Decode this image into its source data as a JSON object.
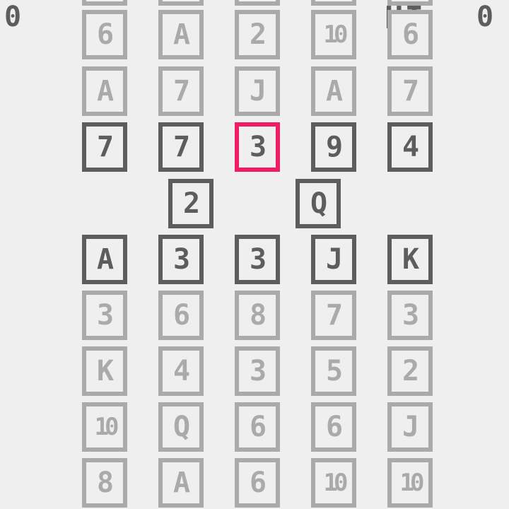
{
  "hud": {
    "score": "0",
    "hi_label": "HI",
    "hi_score": "0"
  },
  "colors": {
    "background": "#efefef",
    "active_card": "#5d5d5d",
    "faded_card": "#aaaaaa",
    "selected_card": "#ef1e62"
  },
  "upper_rows": [
    {
      "cards": [
        "",
        "",
        "",
        "",
        ""
      ],
      "state": "faded"
    },
    {
      "cards": [
        "6",
        "A",
        "2",
        "10",
        "6"
      ],
      "state": "faded"
    },
    {
      "cards": [
        "A",
        "7",
        "J",
        "A",
        "7"
      ],
      "state": "faded"
    },
    {
      "cards": [
        "7",
        "7",
        "3",
        "9",
        "4"
      ],
      "state": "active",
      "selected_index": 2
    }
  ],
  "hand": [
    "2",
    "Q"
  ],
  "lower_rows": [
    {
      "cards": [
        "A",
        "3",
        "3",
        "J",
        "K"
      ],
      "state": "active"
    },
    {
      "cards": [
        "3",
        "6",
        "8",
        "7",
        "3"
      ],
      "state": "faded"
    },
    {
      "cards": [
        "K",
        "4",
        "3",
        "5",
        "2"
      ],
      "state": "faded"
    },
    {
      "cards": [
        "10",
        "Q",
        "6",
        "6",
        "J"
      ],
      "state": "faded"
    },
    {
      "cards": [
        "8",
        "A",
        "6",
        "10",
        "10"
      ],
      "state": "faded"
    }
  ]
}
